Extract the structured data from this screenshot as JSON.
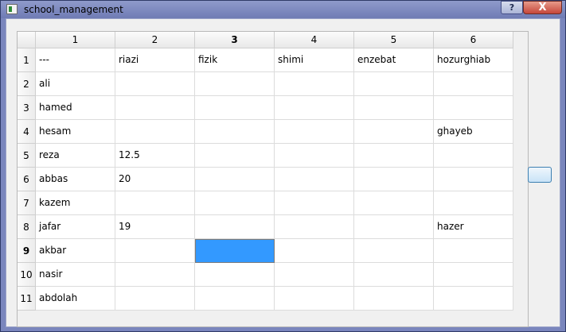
{
  "window": {
    "title": "school_management",
    "help_label": "?",
    "close_label": "X"
  },
  "table": {
    "columns": [
      "1",
      "2",
      "3",
      "4",
      "5",
      "6"
    ],
    "active_column": "3",
    "rows": [
      {
        "header": "1",
        "cells": [
          "---",
          "riazi",
          "fizik",
          "shimi",
          "enzebat",
          "hozurghiab"
        ]
      },
      {
        "header": "2",
        "cells": [
          "ali",
          "",
          "",
          "",
          "",
          ""
        ]
      },
      {
        "header": "3",
        "cells": [
          "hamed",
          "",
          "",
          "",
          "",
          ""
        ]
      },
      {
        "header": "4",
        "cells": [
          "hesam",
          "",
          "",
          "",
          "",
          "ghayeb"
        ]
      },
      {
        "header": "5",
        "cells": [
          "reza",
          "12.5",
          "",
          "",
          "",
          ""
        ]
      },
      {
        "header": "6",
        "cells": [
          "abbas",
          "20",
          "",
          "",
          "",
          ""
        ]
      },
      {
        "header": "7",
        "cells": [
          "kazem",
          "",
          "",
          "",
          "",
          ""
        ]
      },
      {
        "header": "8",
        "cells": [
          "jafar",
          "19",
          "",
          "",
          "",
          "hazer"
        ]
      },
      {
        "header": "9",
        "cells": [
          "akbar",
          "",
          "",
          "",
          "",
          ""
        ]
      },
      {
        "header": "10",
        "cells": [
          "nasir",
          "",
          "",
          "",
          "",
          ""
        ]
      },
      {
        "header": "11",
        "cells": [
          "abdolah",
          "",
          "",
          "",
          "",
          ""
        ]
      }
    ],
    "active_row": "9",
    "selected_cell": {
      "row": "9",
      "column": "3"
    }
  },
  "side_button": {
    "label": ""
  },
  "colors": {
    "selection": "#3399ff",
    "titlebar": "#7a86bd"
  }
}
